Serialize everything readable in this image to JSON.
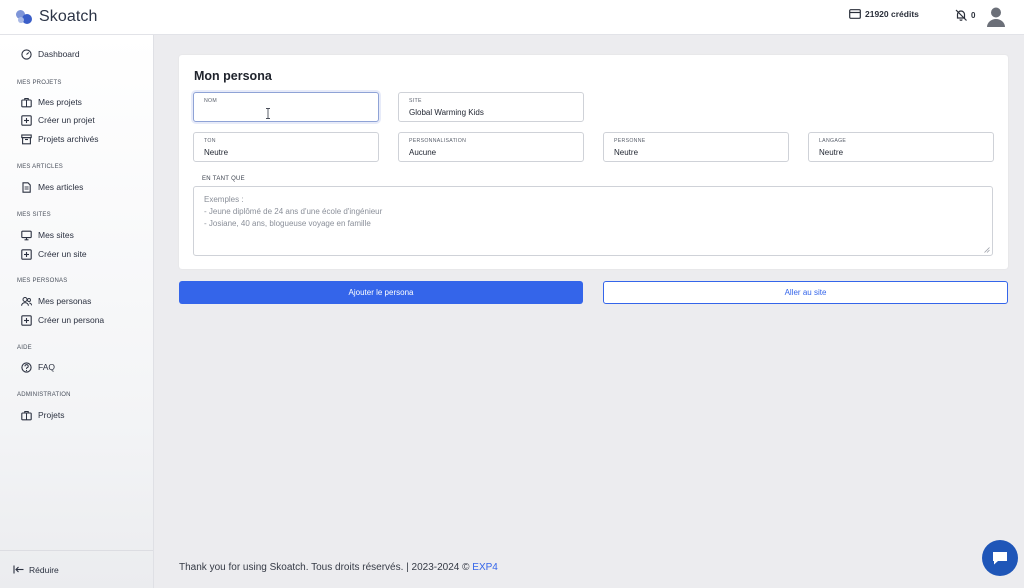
{
  "brand": {
    "name": "Skoatch",
    "colors": {
      "primary": "#3465ea",
      "chat": "#1f56b8"
    }
  },
  "topbar": {
    "credits": "21920 crédits",
    "notifications": "0",
    "credits_icon": "card-icon",
    "bell_icon": "bell-off-icon",
    "avatar_icon": "user-icon"
  },
  "sidebar": {
    "dashboard": "Dashboard",
    "sections": [
      {
        "label": "MES PROJETS",
        "items": [
          "Mes projets",
          "Créer un projet",
          "Projets archivés"
        ]
      },
      {
        "label": "MES ARTICLES",
        "items": [
          "Mes articles"
        ]
      },
      {
        "label": "MES SITES",
        "items": [
          "Mes sites",
          "Créer un site"
        ]
      },
      {
        "label": "MES PERSONAS",
        "items": [
          "Mes personas",
          "Créer un persona"
        ]
      },
      {
        "label": "AIDE",
        "items": [
          "FAQ"
        ]
      },
      {
        "label": "ADMINISTRATION",
        "items": [
          "Projets"
        ]
      }
    ],
    "reduce": "Réduire"
  },
  "form": {
    "title": "Mon persona",
    "fields": {
      "nom": {
        "label": "NOM",
        "value": ""
      },
      "site": {
        "label": "SITE",
        "value": "Global Warming Kids"
      },
      "ton": {
        "label": "TON",
        "value": "Neutre"
      },
      "personnalisation": {
        "label": "PERSONNALISATION",
        "value": "Aucune"
      },
      "personne": {
        "label": "PERSONNE",
        "value": "Neutre"
      },
      "langage": {
        "label": "LANGAGE",
        "value": "Neutre"
      }
    },
    "textarea": {
      "label": "EN TANT QUE",
      "placeholder_lines": [
        "Exemples :",
        "- Jeune diplômé de 24 ans d'une école d'ingénieur",
        "- Josiane, 40 ans, blogueuse voyage en famille"
      ]
    },
    "add_button": "Ajouter le persona",
    "site_button": "Aller au site"
  },
  "footer": {
    "text": "Thank you for using Skoatch. Tous droits réservés. | 2023-2024 © ",
    "link": "EXP4"
  }
}
